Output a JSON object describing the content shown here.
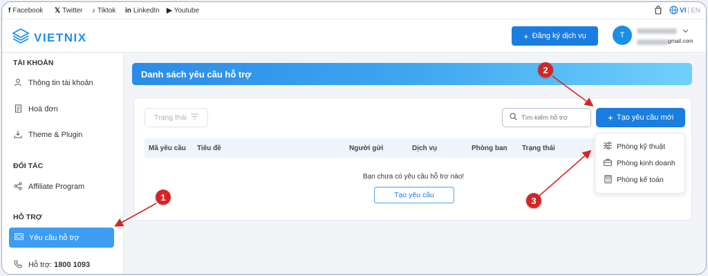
{
  "social": [
    {
      "icon": "facebook-icon",
      "glyph": "f",
      "label": "Facebook"
    },
    {
      "icon": "twitter-icon",
      "glyph": "𝕏",
      "label": "Twitter"
    },
    {
      "icon": "tiktok-icon",
      "glyph": "♪",
      "label": "Tiktok"
    },
    {
      "icon": "linkedin-icon",
      "glyph": "in",
      "label": "LinkedIn"
    },
    {
      "icon": "youtube-icon",
      "glyph": "▶",
      "label": "Youtube"
    }
  ],
  "lang": {
    "vi": "VI",
    "sep": "|",
    "en": "EN"
  },
  "brand": {
    "name": "VIETNIX",
    "accent": "#1a7de0"
  },
  "header": {
    "register_label": "Đăng ký dịch vụ",
    "avatar_letter": "T",
    "email_suffix": "gmail.com"
  },
  "sidebar": {
    "section_account": "TÀI KHOẢN",
    "account_info": "Thông tin tài khoản",
    "invoices": "Hoá đơn",
    "themes": "Theme & Plugin",
    "section_partner": "ĐỐI TÁC",
    "affiliate": "Affiliate Program",
    "section_support": "HỖ TRỢ",
    "support_requests": "Yêu cầu hỗ trợ",
    "hotline_label": "Hỗ trợ:",
    "hotline_number": "1800 1093"
  },
  "page": {
    "title": "Danh sách yêu cầu hỗ trợ"
  },
  "toolbar": {
    "status_filter": "Trạng thái",
    "search_placeholder": "Tìm kiếm hỗ trợ",
    "create_label": "Tạo yêu cầu mới"
  },
  "table": {
    "columns": [
      "Mã yêu cầu",
      "Tiêu đề",
      "Người gửi",
      "Dịch vụ",
      "Phòng ban",
      "Trạng thái"
    ],
    "empty_text": "Bạn chưa có yêu cầu hỗ trợ nào!",
    "empty_button": "Tạo yêu cầu"
  },
  "dropdown": {
    "items": [
      "Phòng kỹ thuật",
      "Phòng kinh doanh",
      "Phòng kế toán"
    ]
  },
  "annotations": {
    "step1": "1",
    "step2": "2",
    "step3": "3",
    "color": "#d62424"
  }
}
